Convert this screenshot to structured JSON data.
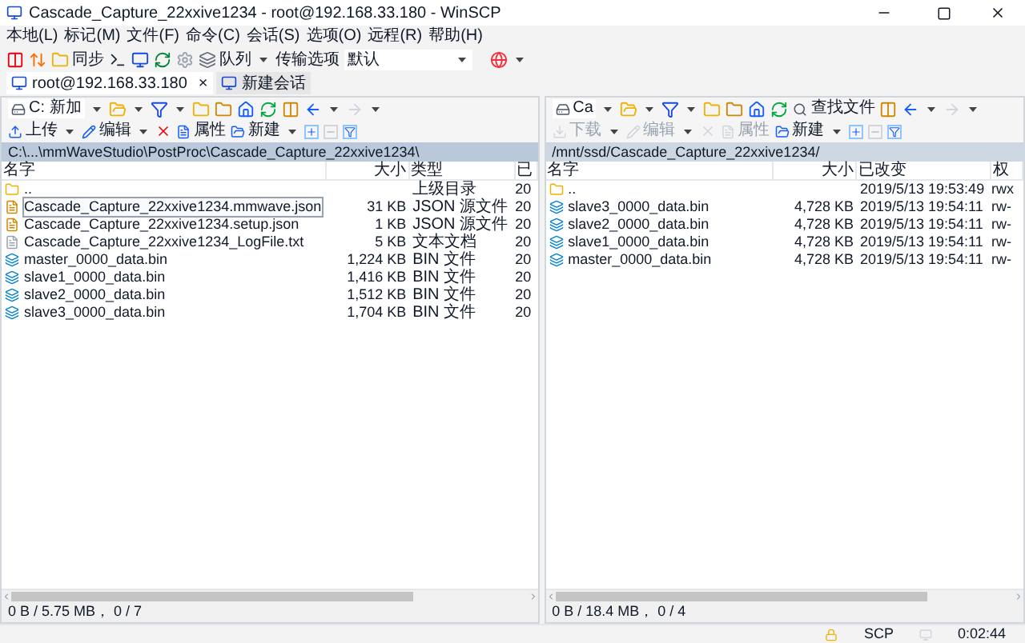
{
  "window": {
    "title": "Cascade_Capture_22xxive1234 - root@192.168.33.180 - WinSCP"
  },
  "menu": [
    "本地(L)",
    "标记(M)",
    "文件(F)",
    "命令(C)",
    "会话(S)",
    "选项(O)",
    "远程(R)",
    "帮助(H)"
  ],
  "toolbar": {
    "sync": "同步",
    "queue": "队列",
    "transfer_label": "传输选项",
    "transfer_value": "默认"
  },
  "tabs": [
    {
      "label": "root@192.168.33.180",
      "selected": true,
      "close": "×"
    },
    {
      "label": "新建会话",
      "selected": false
    }
  ],
  "panels": [
    {
      "active": true,
      "drive": "C: 新加",
      "buttons": [
        {
          "label": "上传",
          "kind": "upload",
          "disabled": false
        },
        {
          "label": "编辑",
          "kind": "edit",
          "disabled": false
        },
        {
          "label": "属性",
          "kind": "props",
          "disabled": false
        },
        {
          "label": "新建",
          "kind": "new",
          "disabled": false
        }
      ],
      "path": "C:\\...\\mmWaveStudio\\PostProc\\Cascade_Capture_22xxive1234\\",
      "columns": [
        "名字",
        "大小",
        "类型",
        "已"
      ],
      "rows": [
        {
          "kind": "parent",
          "name": "..",
          "size": "",
          "col3": "上级目录",
          "col4": "20",
          "focused": false
        },
        {
          "kind": "json",
          "name": "Cascade_Capture_22xxive1234.mmwave.json",
          "size": "31 KB",
          "col3": "JSON 源文件",
          "col4": "20",
          "focused": true
        },
        {
          "kind": "json",
          "name": "Cascade_Capture_22xxive1234.setup.json",
          "size": "1 KB",
          "col3": "JSON 源文件",
          "col4": "20",
          "focused": false
        },
        {
          "kind": "text",
          "name": "Cascade_Capture_22xxive1234_LogFile.txt",
          "size": "5 KB",
          "col3": "文本文档",
          "col4": "20",
          "focused": false
        },
        {
          "kind": "bin",
          "name": "master_0000_data.bin",
          "size": "1,224 KB",
          "col3": "BIN 文件",
          "col4": "20",
          "focused": false
        },
        {
          "kind": "bin",
          "name": "slave1_0000_data.bin",
          "size": "1,416 KB",
          "col3": "BIN 文件",
          "col4": "20",
          "focused": false
        },
        {
          "kind": "bin",
          "name": "slave2_0000_data.bin",
          "size": "1,512 KB",
          "col3": "BIN 文件",
          "col4": "20",
          "focused": false
        },
        {
          "kind": "bin",
          "name": "slave3_0000_data.bin",
          "size": "1,704 KB",
          "col3": "BIN 文件",
          "col4": "20",
          "focused": false
        }
      ],
      "status": "0 B / 5.75 MB， 0 / 7"
    },
    {
      "active": false,
      "drive": "Ca",
      "find": "查找文件",
      "buttons": [
        {
          "label": "下载",
          "kind": "download",
          "disabled": true
        },
        {
          "label": "编辑",
          "kind": "edit",
          "disabled": true
        },
        {
          "label": "属性",
          "kind": "props",
          "disabled": true
        },
        {
          "label": "新建",
          "kind": "new",
          "disabled": false
        }
      ],
      "path": "/mnt/ssd/Cascade_Capture_22xxive1234/",
      "columns": [
        "名字",
        "大小",
        "已改变",
        "权"
      ],
      "rows": [
        {
          "kind": "parent",
          "name": "..",
          "size": "",
          "col3": "2019/5/13 19:53:49",
          "col4": "rwx",
          "focused": false
        },
        {
          "kind": "bin",
          "name": "slave3_0000_data.bin",
          "size": "4,728 KB",
          "col3": "2019/5/13 19:54:11",
          "col4": "rw-",
          "focused": false
        },
        {
          "kind": "bin",
          "name": "slave2_0000_data.bin",
          "size": "4,728 KB",
          "col3": "2019/5/13 19:54:11",
          "col4": "rw-",
          "focused": false
        },
        {
          "kind": "bin",
          "name": "slave1_0000_data.bin",
          "size": "4,728 KB",
          "col3": "2019/5/13 19:54:11",
          "col4": "rw-",
          "focused": false
        },
        {
          "kind": "bin",
          "name": "master_0000_data.bin",
          "size": "4,728 KB",
          "col3": "2019/5/13 19:54:11",
          "col4": "rw-",
          "focused": false
        }
      ],
      "status": "0 B / 18.4 MB， 0 / 4"
    }
  ],
  "status_bar": {
    "protocol": "SCP",
    "time": "0:02:44"
  }
}
